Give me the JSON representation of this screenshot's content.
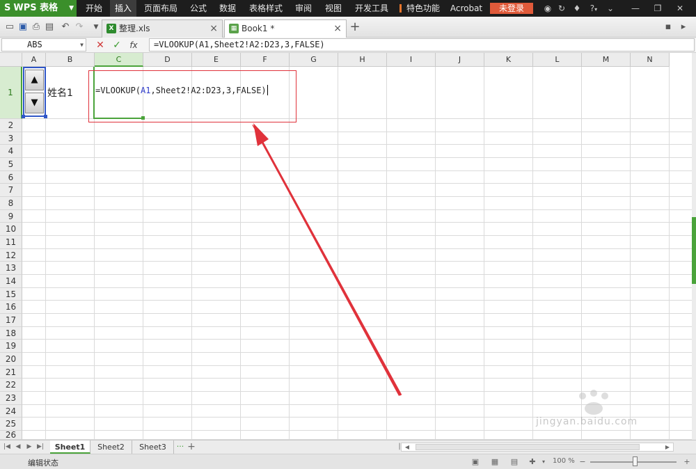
{
  "app": {
    "name": "WPS 表格",
    "logo": "S",
    "colors": {
      "brand": "#3b8f2b",
      "menubar": "#1d1d1d",
      "login": "#e05a3a",
      "selection": "#4aa33a",
      "annotation": "#e0323b"
    }
  },
  "menu": {
    "items": [
      "开始",
      "插入",
      "页面布局",
      "公式",
      "数据",
      "表格样式",
      "审阅",
      "视图",
      "开发工具",
      "特色功能",
      "Acrobat"
    ],
    "active": "插入",
    "login": "未登录",
    "help": "?",
    "icons": [
      "theme-icon",
      "sync-icon",
      "skin-icon",
      "help-icon",
      "minimize-icon",
      "restore-icon",
      "close-icon"
    ]
  },
  "tabs": [
    {
      "label": "整理.xls",
      "icon": "x",
      "active": false
    },
    {
      "label": "Book1 *",
      "icon": "doc",
      "active": true
    }
  ],
  "toolbar": {
    "quick_access_icons": [
      "open-icon",
      "save-icon",
      "print-icon",
      "preview-icon",
      "undo-icon",
      "redo-icon",
      "customize-icon"
    ],
    "new_tab": "+"
  },
  "formula_bar": {
    "name_box": "ABS",
    "cancel": "✕",
    "confirm": "✓",
    "fx": "fx",
    "formula": "=VLOOKUP(A1,Sheet2!A2:D23,3,FALSE)"
  },
  "grid": {
    "columns": [
      "A",
      "B",
      "C",
      "D",
      "E",
      "F",
      "G",
      "H",
      "I",
      "J",
      "K",
      "L",
      "M",
      "N"
    ],
    "selected_column": "C",
    "rows": [
      "1",
      "2",
      "3",
      "4",
      "5",
      "6",
      "7",
      "8",
      "9",
      "10",
      "11",
      "12",
      "13",
      "14",
      "15",
      "16",
      "17",
      "18",
      "19",
      "20",
      "21",
      "22",
      "23",
      "24",
      "25",
      "26"
    ],
    "selected_row": "1",
    "cells": {
      "B1": "姓名1",
      "C1_prefix": "=VLOOKUP(",
      "C1_ref": "A1",
      "C1_suffix": ",Sheet2!A2:D23,3,FALSE)"
    },
    "spin_up": "▲",
    "spin_down": "▼"
  },
  "sheets": {
    "tabs": [
      "Sheet1",
      "Sheet2",
      "Sheet3"
    ],
    "active": "Sheet1",
    "more": "···",
    "add": "+"
  },
  "status": {
    "text": "编辑状态",
    "zoom": "100 %",
    "zoom_minus": "−",
    "zoom_plus": "+"
  },
  "watermark": {
    "text": "jingyan.baidu.com"
  }
}
